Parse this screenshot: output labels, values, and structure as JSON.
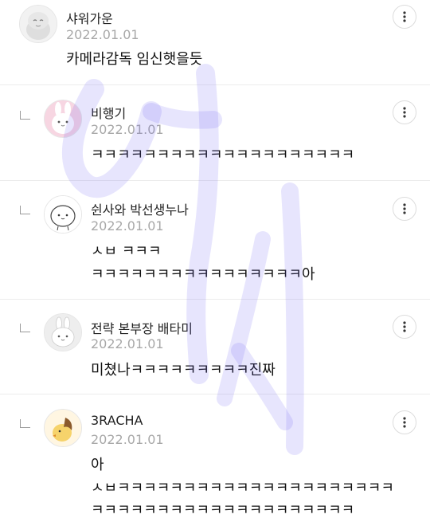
{
  "comments": [
    {
      "author": "샤워가운",
      "date": "2022.01.01",
      "lines": [
        "카메라감독 임신햇을듯"
      ],
      "is_reply": false,
      "avatar": "gray-rabbit-icon"
    },
    {
      "author": "비행기",
      "date": "2022.01.01",
      "lines": [
        "ㅋㅋㅋㅋㅋㅋㅋㅋㅋㅋㅋㅋㅋㅋㅋㅋㅋㅋㅋㅋ"
      ],
      "is_reply": true,
      "avatar": "pink-rabbit-icon"
    },
    {
      "author": "쉰사와 박선생누나",
      "date": "2022.01.01",
      "lines": [
        "ㅅㅂ ㅋㅋㅋ",
        "ㅋㅋㅋㅋㅋㅋㅋㅋㅋㅋㅋㅋㅋㅋㅋㅋ아"
      ],
      "is_reply": true,
      "avatar": "white-blob-icon"
    },
    {
      "author": "전략 본부장 배타미",
      "date": "2022.01.01",
      "lines": [
        "미쳤나ㅋㅋㅋㅋㅋㅋㅋㅋㅋ진짜"
      ],
      "is_reply": true,
      "avatar": "white-rabbit-icon"
    },
    {
      "author": "3RACHA",
      "date": "2022.01.01",
      "lines": [
        "아",
        "ㅅㅂㅋㅋㅋㅋㅋㅋㅋㅋㅋㅋㅋㅋㅋㅋㅋㅋㅋㅋㅋㅋㅋ",
        "ㅋㅋㅋㅋㅋㅋㅋㅋㅋㅋㅋㅋㅋㅋㅋㅋㅋㅋㅋㅋ"
      ],
      "is_reply": true,
      "avatar": "yellow-chick-icon"
    }
  ],
  "icons": {
    "more": "more-vertical-icon",
    "reply": "reply-indent-icon"
  },
  "colors": {
    "name": "#222222",
    "date": "#a8a8a8",
    "divider": "#ececec",
    "watermark": "#6a5cf5"
  }
}
